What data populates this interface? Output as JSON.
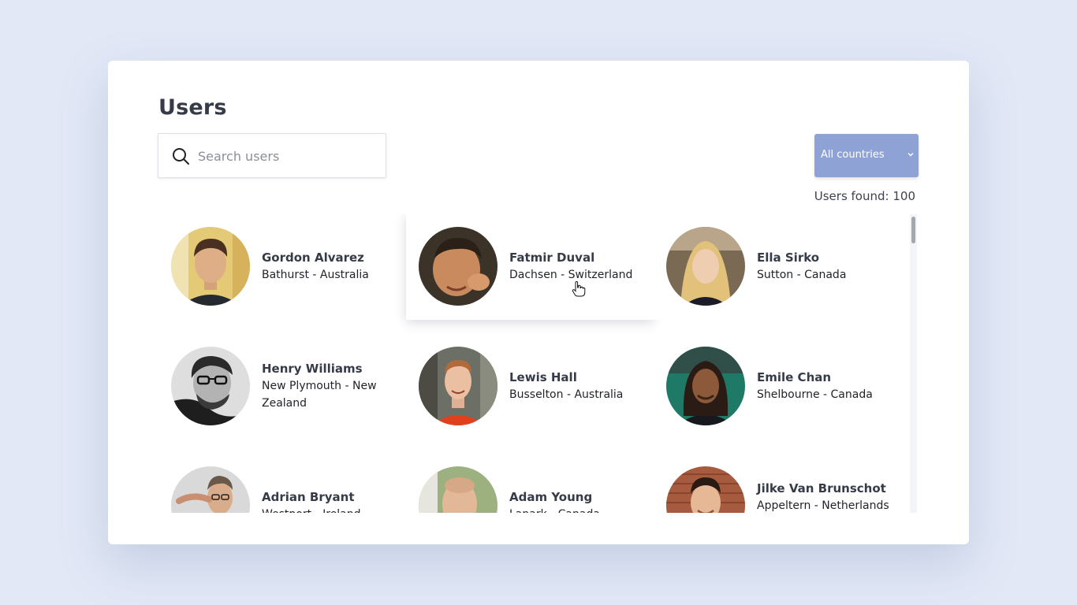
{
  "page": {
    "title": "Users"
  },
  "search": {
    "placeholder": "Search users",
    "value": ""
  },
  "filter": {
    "selected": "All countries",
    "accent_color": "#8ea2d5"
  },
  "results": {
    "label": "Users found:",
    "count": "100"
  },
  "users": [
    {
      "name": "Gordon Alvarez",
      "location": "Bathurst - Australia"
    },
    {
      "name": "Fatmir Duval",
      "location": "Dachsen - Switzerland"
    },
    {
      "name": "Ella Sirko",
      "location": "Sutton - Canada"
    },
    {
      "name": "Henry Williams",
      "location": "New Plymouth - New Zealand"
    },
    {
      "name": "Lewis Hall",
      "location": "Busselton - Australia"
    },
    {
      "name": "Emile Chan",
      "location": "Shelbourne - Canada"
    },
    {
      "name": "Adrian Bryant",
      "location": "Westport - Ireland"
    },
    {
      "name": "Adam Young",
      "location": "Lanark - Canada"
    },
    {
      "name": "Jilke Van Brunschot",
      "location": "Appeltern - Netherlands"
    }
  ],
  "icons": {
    "search": "search-icon",
    "dropdown": "chevron-down-icon",
    "cursor": "hand-pointer-icon"
  }
}
